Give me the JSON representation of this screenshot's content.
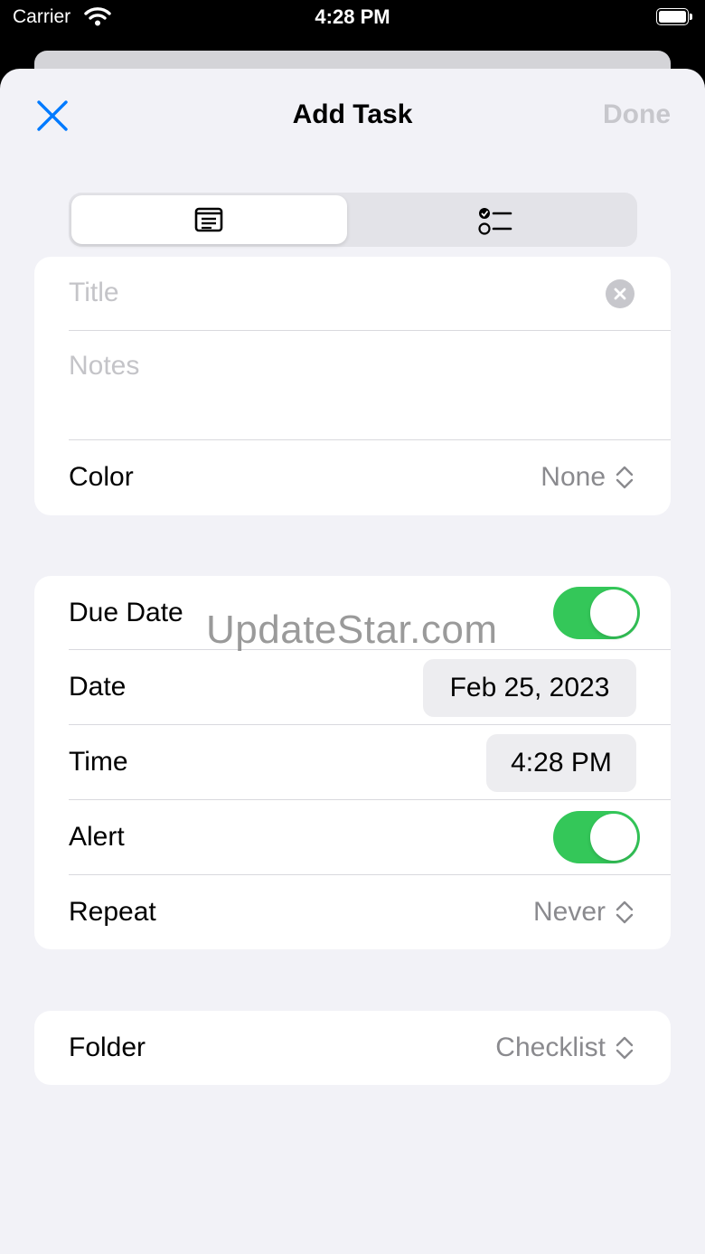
{
  "status_bar": {
    "carrier": "Carrier",
    "time": "4:28 PM"
  },
  "nav": {
    "title": "Add Task",
    "done_label": "Done"
  },
  "segment": {
    "selected": "details-icon"
  },
  "title_field": {
    "placeholder": "Title"
  },
  "notes_field": {
    "placeholder": "Notes"
  },
  "color_row": {
    "label": "Color",
    "value": "None"
  },
  "due_date_row": {
    "label": "Due Date",
    "enabled": true
  },
  "date_row": {
    "label": "Date",
    "value": "Feb 25, 2023"
  },
  "time_row": {
    "label": "Time",
    "value": "4:28 PM"
  },
  "alert_row": {
    "label": "Alert",
    "enabled": true
  },
  "repeat_row": {
    "label": "Repeat",
    "value": "Never"
  },
  "folder_row": {
    "label": "Folder",
    "value": "Checklist"
  },
  "watermark": "UpdateStar.com",
  "colors": {
    "accent": "#007aff",
    "toggle_on": "#34c759",
    "background": "#f2f2f7"
  }
}
